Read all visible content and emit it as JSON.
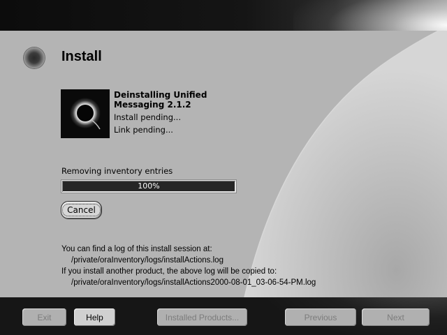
{
  "header": {
    "title": "Install"
  },
  "product": {
    "title": "Deinstalling Unified Messaging 2.1.2",
    "status_install": "Install pending...",
    "status_link": "Link pending..."
  },
  "progress": {
    "label": "Removing inventory entries",
    "percent": 100,
    "text": "100%"
  },
  "actions": {
    "cancel_label": "Cancel"
  },
  "log": {
    "line1": "You can find a log of this install session at:",
    "path1": "/private/oraInventory/logs/installActions.log",
    "line2": "If you install another product, the above log will be copied to:",
    "path2": "/private/oraInventory/logs/installActions2000-08-01_03-06-54-PM.log"
  },
  "footer": {
    "exit_label": "Exit",
    "help_label": "Help",
    "installed_products_label": "Installed Products...",
    "previous_label": "Previous",
    "next_label": "Next"
  },
  "icons": {
    "title_orb": "orb-icon",
    "product_image": "eclipse-icon"
  },
  "colors": {
    "panel": "#b4b4b4",
    "band": "#161616",
    "progress_fill": "#262626"
  }
}
